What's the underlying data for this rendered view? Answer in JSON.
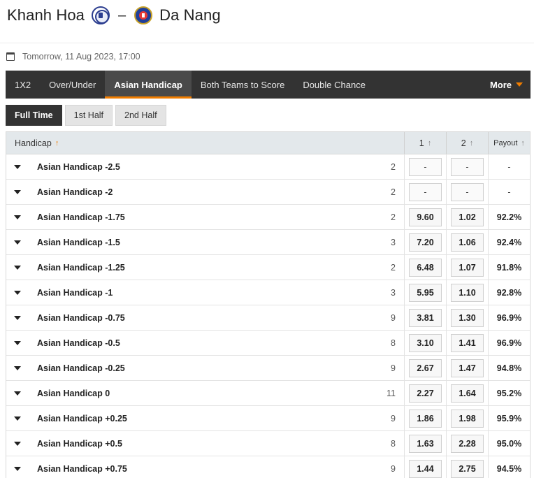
{
  "match": {
    "home_team": "Khanh Hoa",
    "away_team": "Da Nang",
    "separator": "–",
    "datetime": "Tomorrow, 11 Aug 2023, 17:00"
  },
  "tabs": [
    {
      "label": "1X2",
      "active": false
    },
    {
      "label": "Over/Under",
      "active": false
    },
    {
      "label": "Asian Handicap",
      "active": true
    },
    {
      "label": "Both Teams to Score",
      "active": false
    },
    {
      "label": "Double Chance",
      "active": false
    }
  ],
  "more_label": "More",
  "periods": [
    {
      "label": "Full Time",
      "active": true
    },
    {
      "label": "1st Half",
      "active": false
    },
    {
      "label": "2nd Half",
      "active": false
    }
  ],
  "table": {
    "headers": {
      "handicap": "Handicap",
      "col1": "1",
      "col2": "2",
      "payout": "Payout"
    },
    "rows": [
      {
        "label": "Asian Handicap -2.5",
        "count": "2",
        "odd1": "-",
        "odd2": "-",
        "payout": "-"
      },
      {
        "label": "Asian Handicap -2",
        "count": "2",
        "odd1": "-",
        "odd2": "-",
        "payout": "-"
      },
      {
        "label": "Asian Handicap -1.75",
        "count": "2",
        "odd1": "9.60",
        "odd2": "1.02",
        "payout": "92.2%"
      },
      {
        "label": "Asian Handicap -1.5",
        "count": "3",
        "odd1": "7.20",
        "odd2": "1.06",
        "payout": "92.4%"
      },
      {
        "label": "Asian Handicap -1.25",
        "count": "2",
        "odd1": "6.48",
        "odd2": "1.07",
        "payout": "91.8%"
      },
      {
        "label": "Asian Handicap -1",
        "count": "3",
        "odd1": "5.95",
        "odd2": "1.10",
        "payout": "92.8%"
      },
      {
        "label": "Asian Handicap -0.75",
        "count": "9",
        "odd1": "3.81",
        "odd2": "1.30",
        "payout": "96.9%"
      },
      {
        "label": "Asian Handicap -0.5",
        "count": "8",
        "odd1": "3.10",
        "odd2": "1.41",
        "payout": "96.9%"
      },
      {
        "label": "Asian Handicap -0.25",
        "count": "9",
        "odd1": "2.67",
        "odd2": "1.47",
        "payout": "94.8%"
      },
      {
        "label": "Asian Handicap 0",
        "count": "11",
        "odd1": "2.27",
        "odd2": "1.64",
        "payout": "95.2%"
      },
      {
        "label": "Asian Handicap +0.25",
        "count": "9",
        "odd1": "1.86",
        "odd2": "1.98",
        "payout": "95.9%"
      },
      {
        "label": "Asian Handicap +0.5",
        "count": "8",
        "odd1": "1.63",
        "odd2": "2.28",
        "payout": "95.0%"
      },
      {
        "label": "Asian Handicap +0.75",
        "count": "9",
        "odd1": "1.44",
        "odd2": "2.75",
        "payout": "94.5%"
      }
    ]
  },
  "colors": {
    "accent": "#f07d00",
    "tabbar": "#333333",
    "header_bg": "#e3e8eb"
  }
}
